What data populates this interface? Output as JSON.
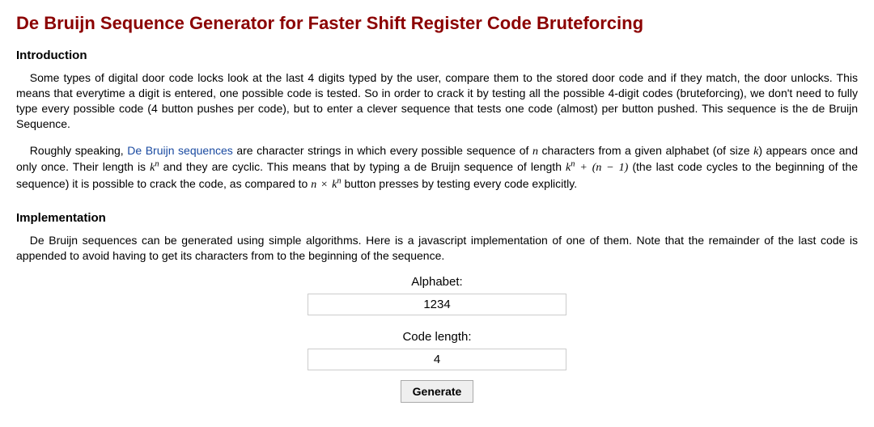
{
  "title": "De Bruijn Sequence Generator for Faster Shift Register Code Bruteforcing",
  "sections": {
    "intro": {
      "heading": "Introduction",
      "p1": "Some types of digital door code locks look at the last 4 digits typed by the user, compare them to the stored door code and if they match, the door unlocks. This means that everytime a digit is entered, one possible code is tested. So in order to crack it by testing all the possible 4-digit codes (bruteforcing), we don't need to fully type every possible code (4 button pushes per code), but to enter a clever sequence that tests one code (almost) per button pushed. This sequence is the de Bruijn Sequence.",
      "p2a": "Roughly speaking, ",
      "p2_link": "De Bruijn sequences",
      "p2b": " are character strings in which every possible sequence of ",
      "p2c": " characters from a given alphabet (of size ",
      "p2d": ") appears once and only once. Their length is ",
      "p2e": " and they are cyclic. This means that by typing a de Bruijn sequence of length ",
      "p2f": " (the last code cycles to the beginning of the sequence) it is possible to crack the code, as compared to ",
      "p2g": " button presses by testing every code explicitly."
    },
    "impl": {
      "heading": "Implementation",
      "p1": "De Bruijn sequences can be generated using simple algorithms. Here is a javascript implementation of one of them. Note that the remainder of the last code is appended to avoid having to get its characters from to the beginning of the sequence."
    }
  },
  "form": {
    "alphabet_label": "Alphabet:",
    "alphabet_value": "1234",
    "length_label": "Code length:",
    "length_value": "4",
    "generate_label": "Generate"
  }
}
